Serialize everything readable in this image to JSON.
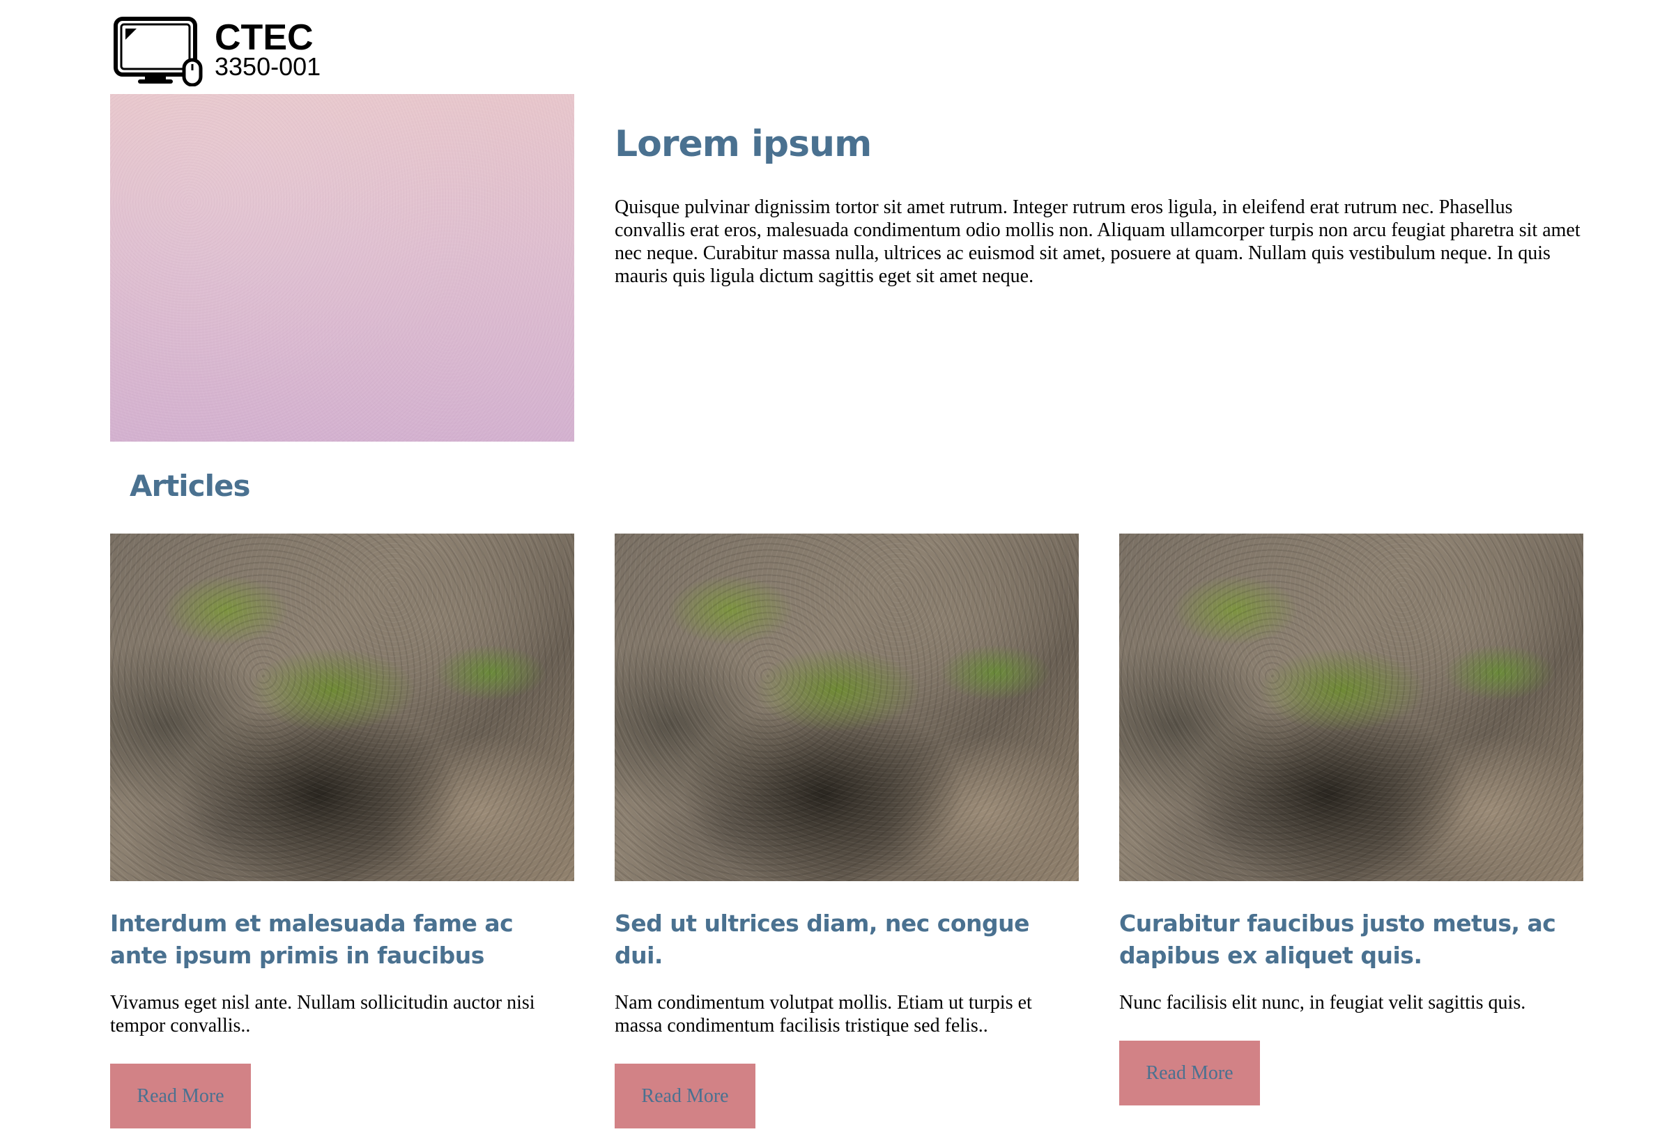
{
  "logo": {
    "title": "CTEC",
    "subtitle": "3350-001",
    "icon": "computer-monitor-mouse-icon"
  },
  "hero": {
    "title": "Lorem ipsum",
    "text": "Quisque pulvinar dignissim tortor sit amet rutrum. Integer rutrum eros ligula, in eleifend erat rutrum nec. Phasellus convallis erat eros, malesuada condimentum odio mollis non. Aliquam ullamcorper turpis non arcu feugiat pharetra sit amet nec neque. Curabitur massa nulla, ultrices ac euismod sit amet, posuere at quam. Nullam quis vestibulum neque. In quis mauris quis ligula dictum sagittis eget sit amet neque."
  },
  "articles_heading": "Articles",
  "articles": [
    {
      "title": "Interdum et malesuada fame ac ante ipsum primis in faucibus",
      "text": "Vivamus eget nisl ante. Nullam sollicitudin auctor nisi tempor convallis..",
      "button": "Read More"
    },
    {
      "title": "Sed ut ultrices diam, nec congue dui.",
      "text": "Nam condimentum volutpat mollis. Etiam ut turpis et massa condimentum facilisis tristique sed felis..",
      "button": "Read More"
    },
    {
      "title": "Curabitur faucibus justo metus, ac dapibus ex aliquet quis.",
      "text": "Nunc facilisis elit nunc, in feugiat velit sagittis quis.",
      "button": "Read More"
    }
  ],
  "colors": {
    "heading": "#4a7190",
    "button_bg": "#d28286",
    "button_text": "#4a7190",
    "body_text": "#000000",
    "background": "#ffffff"
  }
}
